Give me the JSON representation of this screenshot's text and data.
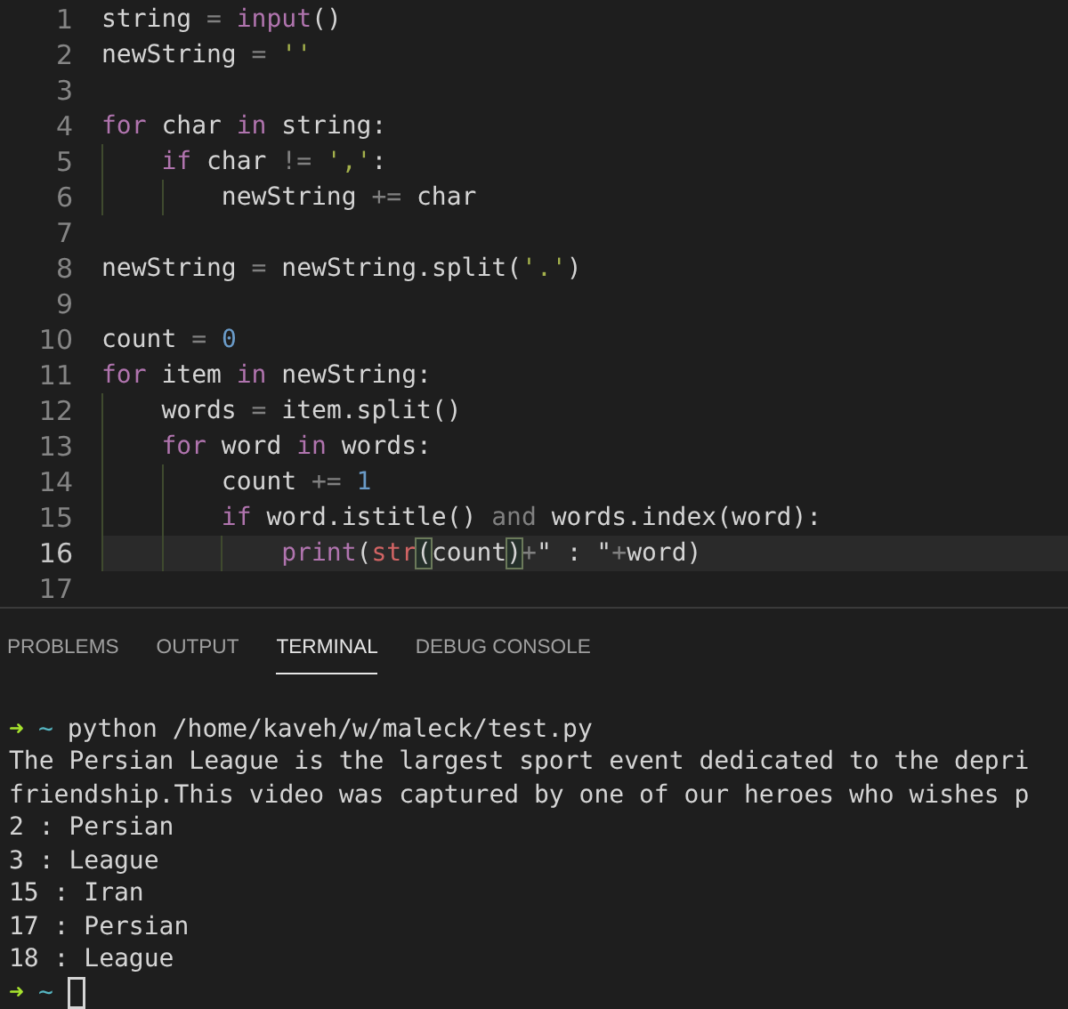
{
  "editor": {
    "lines": [
      {
        "number": "1",
        "active": false,
        "tokens": [
          {
            "t": "string",
            "kind": "plain"
          },
          {
            "t": " = ",
            "kind": "op"
          },
          {
            "t": "input",
            "kind": "func"
          },
          {
            "t": "()",
            "kind": "plain"
          }
        ]
      },
      {
        "number": "2",
        "active": false,
        "tokens": [
          {
            "t": "newString",
            "kind": "plain"
          },
          {
            "t": " = ",
            "kind": "op"
          },
          {
            "t": "''",
            "kind": "string"
          }
        ]
      },
      {
        "number": "3",
        "active": false
      },
      {
        "number": "4",
        "active": false,
        "tokens": [
          {
            "t": "for",
            "kind": "keyword"
          },
          {
            "t": " char ",
            "kind": "plain"
          },
          {
            "t": "in",
            "kind": "keyword"
          },
          {
            "t": " string:",
            "kind": "plain"
          }
        ],
        "children": [
          {
            "number": "5",
            "active": false,
            "tokens": [
              {
                "t": "if",
                "kind": "keyword"
              },
              {
                "t": " char ",
                "kind": "plain"
              },
              {
                "t": "!=",
                "kind": "op"
              },
              {
                "t": " ','",
                "kind": "string"
              },
              {
                "t": ":",
                "kind": "plain"
              }
            ],
            "children": [
              {
                "number": "6",
                "active": false,
                "tokens": [
                  {
                    "t": "newString ",
                    "kind": "plain"
                  },
                  {
                    "t": "+=",
                    "kind": "op"
                  },
                  {
                    "t": " char",
                    "kind": "plain"
                  }
                ]
              }
            ]
          }
        ]
      },
      {
        "number": "7",
        "active": false
      },
      {
        "number": "8",
        "active": false,
        "tokens": [
          {
            "t": "newString",
            "kind": "plain"
          },
          {
            "t": " = ",
            "kind": "op"
          },
          {
            "t": "newString.split(",
            "kind": "plain"
          },
          {
            "t": "'.'",
            "kind": "string"
          },
          {
            "t": ")",
            "kind": "plain"
          }
        ]
      },
      {
        "number": "9",
        "active": false
      },
      {
        "number": "10",
        "active": false,
        "tokens": [
          {
            "t": "count",
            "kind": "plain"
          },
          {
            "t": " = ",
            "kind": "op"
          },
          {
            "t": "0",
            "kind": "number"
          }
        ]
      },
      {
        "number": "11",
        "active": false,
        "tokens": [
          {
            "t": "for",
            "kind": "keyword"
          },
          {
            "t": " item ",
            "kind": "plain"
          },
          {
            "t": "in",
            "kind": "keyword"
          },
          {
            "t": " newString:",
            "kind": "plain"
          }
        ],
        "children": [
          {
            "number": "12",
            "active": false,
            "tokens": [
              {
                "t": "words",
                "kind": "plain"
              },
              {
                "t": " = ",
                "kind": "op"
              },
              {
                "t": "item.split()",
                "kind": "plain"
              }
            ]
          },
          {
            "number": "13",
            "active": false,
            "tokens": [
              {
                "t": "for",
                "kind": "keyword"
              },
              {
                "t": " word ",
                "kind": "plain"
              },
              {
                "t": "in",
                "kind": "keyword"
              },
              {
                "t": " words:",
                "kind": "plain"
              }
            ],
            "children": [
              {
                "number": "14",
                "active": false,
                "tokens": [
                  {
                    "t": "count ",
                    "kind": "plain"
                  },
                  {
                    "t": "+=",
                    "kind": "op"
                  },
                  {
                    "t": " 1",
                    "kind": "number"
                  }
                ]
              },
              {
                "number": "15",
                "active": false,
                "tokens": [
                  {
                    "t": "if",
                    "kind": "keyword"
                  },
                  {
                    "t": " word.istitle() ",
                    "kind": "plain"
                  },
                  {
                    "t": "and",
                    "kind": "op"
                  },
                  {
                    "t": " words.index(word):",
                    "kind": "plain"
                  }
                ],
                "children": [
                  {
                    "number": "16",
                    "active": true,
                    "tokens": [
                      {
                        "t": "print",
                        "kind": "func"
                      },
                      {
                        "t": "(",
                        "kind": "plain"
                      },
                      {
                        "t": "str",
                        "kind": "builtin"
                      },
                      {
                        "t": "(",
                        "kind": "bracket"
                      },
                      {
                        "t": "count",
                        "kind": "plain"
                      },
                      {
                        "t": ")",
                        "kind": "bracket"
                      },
                      {
                        "t": "+",
                        "kind": "op"
                      },
                      {
                        "t": "\" : \"",
                        "kind": "plain"
                      },
                      {
                        "t": "+",
                        "kind": "op"
                      },
                      {
                        "t": "word)",
                        "kind": "plain"
                      }
                    ]
                  }
                ]
              }
            ]
          }
        ]
      },
      {
        "number": "17",
        "active": false
      }
    ]
  },
  "panel": {
    "tabs": [
      {
        "label": "PROBLEMS",
        "selected": false
      },
      {
        "label": "OUTPUT",
        "selected": false
      },
      {
        "label": "TERMINAL",
        "selected": true
      },
      {
        "label": "DEBUG CONSOLE",
        "selected": false
      }
    ]
  },
  "terminal": {
    "lines": [
      {
        "kind": "prompt",
        "prompt": "➜",
        "dir": "~",
        "text": "python /home/kaveh/w/maleck/test.py"
      },
      {
        "kind": "output",
        "text": "The Persian League is the largest sport event dedicated to the depri"
      },
      {
        "kind": "output",
        "text": "friendship.This video was captured by one of our heroes who wishes p"
      },
      {
        "kind": "output",
        "text": "2 : Persian"
      },
      {
        "kind": "output",
        "text": "3 : League"
      },
      {
        "kind": "output",
        "text": "15 : Iran"
      },
      {
        "kind": "output",
        "text": "17 : Persian"
      },
      {
        "kind": "output",
        "text": "18 : League"
      },
      {
        "kind": "input",
        "prompt": "➜",
        "dir": "~"
      }
    ]
  }
}
